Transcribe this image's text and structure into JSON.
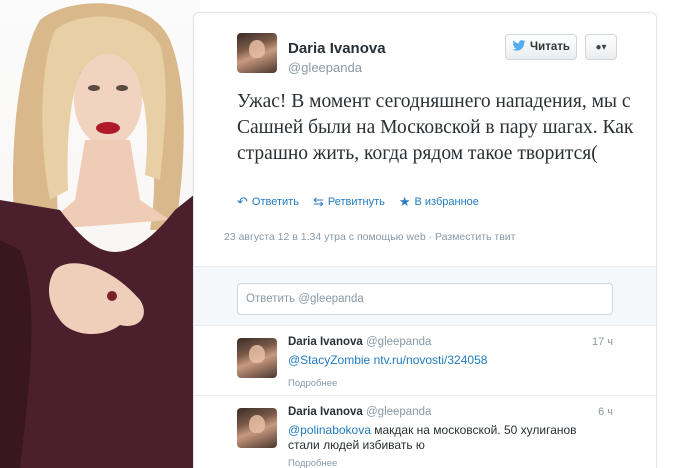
{
  "tweet": {
    "author_name": "Daria Ivanova",
    "author_handle": "@gleepanda",
    "follow_label": "Читать",
    "text": "Ужас! В момент сегодняшнего нападения, мы с Сашней были на Московской в пару шагах. Как страшно жить, когда рядом такое творится(",
    "actions": {
      "reply": "Ответить",
      "retweet": "Ретвитнуть",
      "favorite": "В избранное"
    },
    "meta": "23 августа 12 в 1:34 утра с помощью web · Разместить твит"
  },
  "reply_box": {
    "placeholder": "Ответить @gleepanda"
  },
  "timeline": [
    {
      "name": "Daria Ivanova",
      "handle": "@gleepanda",
      "time": "17 ч",
      "mention": "@StacyZombie",
      "link": "ntv.ru/novosti/324058",
      "body": "",
      "more": "Подробнее"
    },
    {
      "name": "Daria Ivanova",
      "handle": "@gleepanda",
      "time": "6 ч",
      "mention": "@polinabokova",
      "link": "",
      "body": " макдак на московской. 50 хулиганов стали людей избивать ю",
      "more": "Подробнее"
    }
  ],
  "colors": {
    "link": "#1f7bc0",
    "muted": "#8899a6"
  }
}
